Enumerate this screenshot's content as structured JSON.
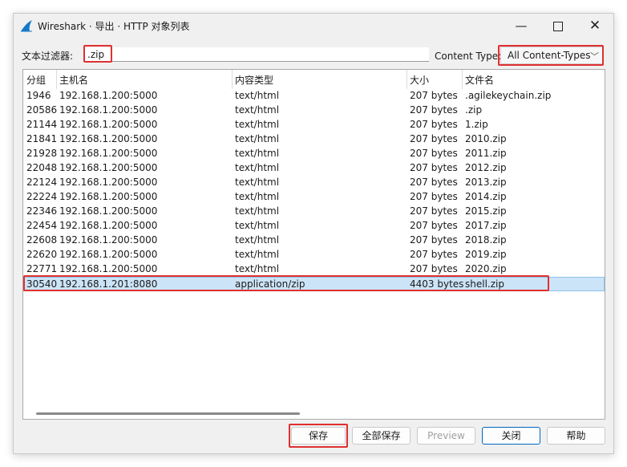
{
  "window": {
    "title": "Wireshark · 导出 · HTTP 对象列表",
    "minimize": "—",
    "close": "✕"
  },
  "filter": {
    "label": "文本过滤器:",
    "value": ".zip"
  },
  "content_type": {
    "label": "Content Type:",
    "selected": "All Content-Types"
  },
  "table": {
    "headers": [
      "分组",
      "主机名",
      "内容类型",
      "大小",
      "文件名"
    ],
    "rows": [
      [
        "1946",
        "192.168.1.200:5000",
        "text/html",
        "207 bytes",
        ".agilekeychain.zip"
      ],
      [
        "20586",
        "192.168.1.200:5000",
        "text/html",
        "207 bytes",
        ".zip"
      ],
      [
        "21144",
        "192.168.1.200:5000",
        "text/html",
        "207 bytes",
        "1.zip"
      ],
      [
        "21841",
        "192.168.1.200:5000",
        "text/html",
        "207 bytes",
        "2010.zip"
      ],
      [
        "21928",
        "192.168.1.200:5000",
        "text/html",
        "207 bytes",
        "2011.zip"
      ],
      [
        "22048",
        "192.168.1.200:5000",
        "text/html",
        "207 bytes",
        "2012.zip"
      ],
      [
        "22124",
        "192.168.1.200:5000",
        "text/html",
        "207 bytes",
        "2013.zip"
      ],
      [
        "22224",
        "192.168.1.200:5000",
        "text/html",
        "207 bytes",
        "2014.zip"
      ],
      [
        "22346",
        "192.168.1.200:5000",
        "text/html",
        "207 bytes",
        "2015.zip"
      ],
      [
        "22454",
        "192.168.1.200:5000",
        "text/html",
        "207 bytes",
        "2017.zip"
      ],
      [
        "22608",
        "192.168.1.200:5000",
        "text/html",
        "207 bytes",
        "2018.zip"
      ],
      [
        "22620",
        "192.168.1.200:5000",
        "text/html",
        "207 bytes",
        "2019.zip"
      ],
      [
        "22771",
        "192.168.1.200:5000",
        "text/html",
        "207 bytes",
        "2020.zip"
      ],
      [
        "30540",
        "192.168.1.201:8080",
        "application/zip",
        "4403 bytes",
        "shell.zip"
      ]
    ],
    "selected_row": 13
  },
  "buttons": {
    "save": "保存",
    "save_all": "全部保存",
    "preview": "Preview",
    "close": "关闭",
    "help": "帮助"
  },
  "colors": {
    "selection": "#cce4f7",
    "highlight": "#e03030",
    "primary_border": "#0067c0"
  }
}
